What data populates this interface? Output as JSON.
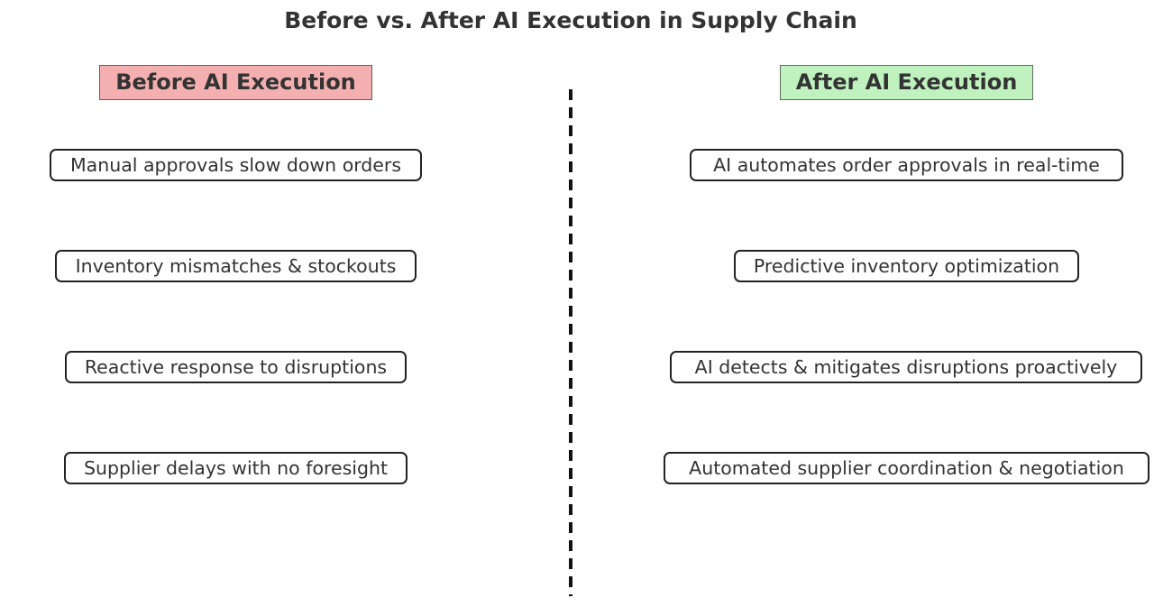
{
  "title": "Before vs. After AI Execution in Supply Chain",
  "before": {
    "header": "Before AI Execution",
    "header_color": "#f4b0b0",
    "items": [
      "Manual approvals slow down orders",
      "Inventory mismatches & stockouts",
      "Reactive response to disruptions",
      "Supplier delays with no foresight"
    ]
  },
  "after": {
    "header": "After AI Execution",
    "header_color": "#bff2bf",
    "items": [
      "AI automates order approvals in real-time",
      "Predictive inventory optimization",
      "AI detects & mitigates disruptions proactively",
      "Automated supplier coordination & negotiation"
    ]
  },
  "divider_style": "dashed"
}
